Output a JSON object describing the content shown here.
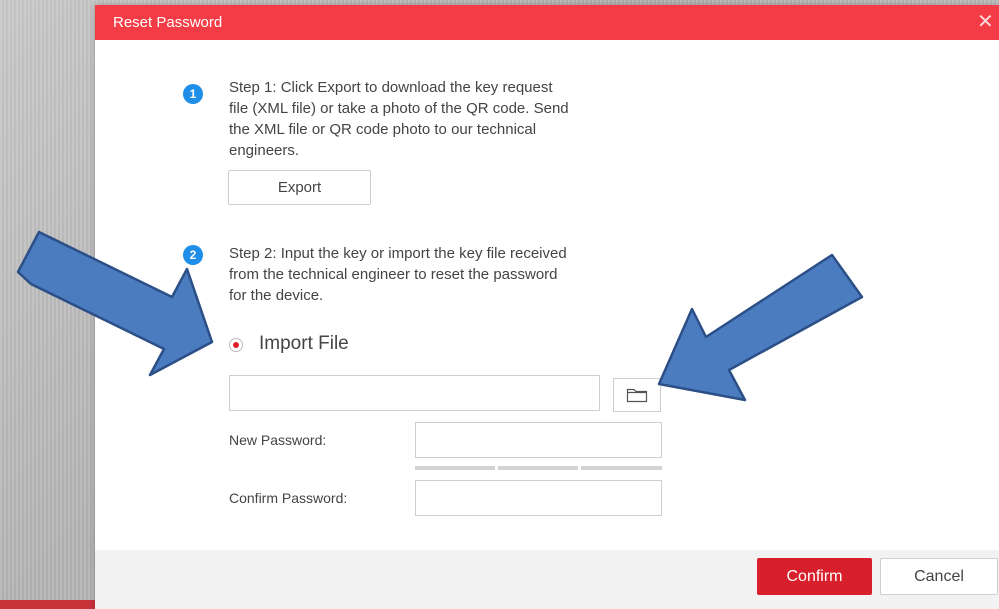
{
  "dialog": {
    "title": "Reset Password",
    "close_symbol": "✕"
  },
  "step1": {
    "number": "1",
    "lines": [
      "Step 1: Click Export to download the key request",
      "file (XML file) or take a photo of the QR code. Send",
      "the XML file or QR code photo to our technical",
      "engineers."
    ],
    "export_label": "Export"
  },
  "step2": {
    "number": "2",
    "lines": [
      "Step 2: Input the key or import the key file received",
      "from the technical engineer to reset the password",
      "for the device."
    ]
  },
  "import": {
    "label": "Import File",
    "selected": true,
    "file_value": ""
  },
  "fields": {
    "new_password_label": "New Password:",
    "new_password_value": "",
    "confirm_password_label": "Confirm Password:",
    "confirm_password_value": "",
    "strength_level": 0
  },
  "footer": {
    "confirm_label": "Confirm",
    "cancel_label": "Cancel"
  },
  "icons": {
    "step_badge": "step-number-icon",
    "browse": "folder-icon",
    "annotation": "arrow-icon"
  },
  "colors": {
    "titlebar": "#f33c45",
    "step_badge": "#1f8ee8",
    "confirm": "#d8202c",
    "annotation_arrow": "#4b7cc0"
  }
}
